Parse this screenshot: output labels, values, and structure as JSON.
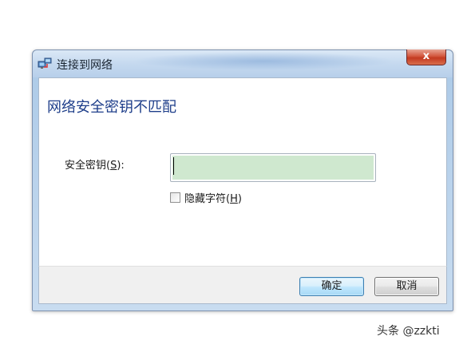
{
  "window": {
    "title": "连接到网络",
    "close_label": "x"
  },
  "content": {
    "heading": "网络安全密钥不匹配",
    "security_key_label_pre": "安全密钥(",
    "security_key_label_accel": "S",
    "security_key_label_post": "):",
    "security_key_value": "",
    "hide_chars_label_pre": "隐藏字符(",
    "hide_chars_label_accel": "H",
    "hide_chars_label_post": ")",
    "hide_chars_checked": false
  },
  "footer": {
    "ok_label": "确定",
    "cancel_label": "取消"
  },
  "watermark": {
    "text": "头条 @zzkti"
  },
  "colors": {
    "heading": "#1e3e8a",
    "input_fill": "#cfe8cf",
    "close_button": "#c33a21",
    "default_button_border": "#3c7fb1"
  }
}
